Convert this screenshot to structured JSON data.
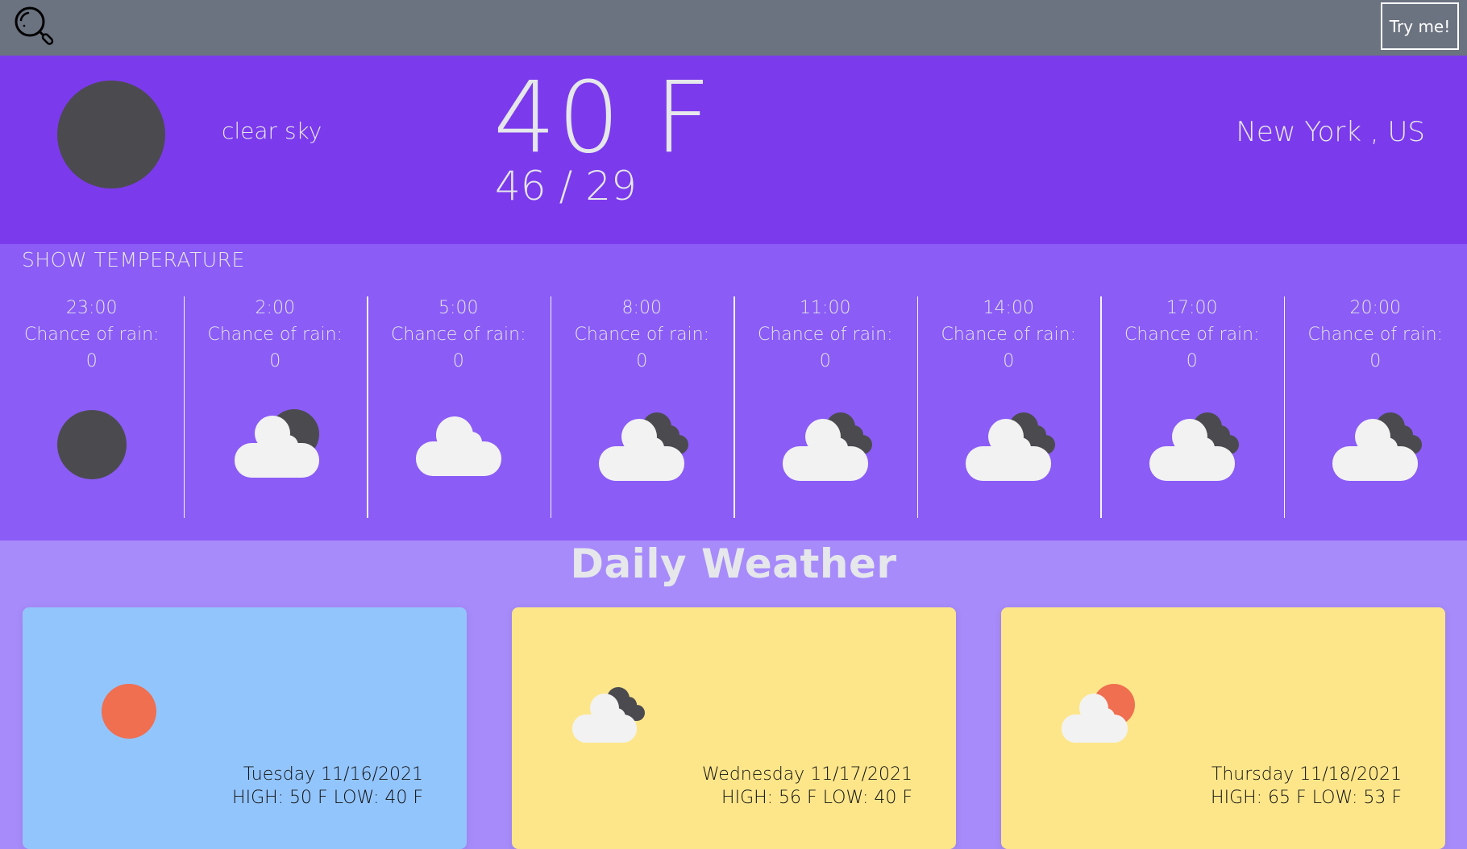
{
  "navbar": {
    "search_icon": "magnifying-glass-icon",
    "try_button_label": "Try me!"
  },
  "current": {
    "icon": "clear-night-icon",
    "description": "clear sky",
    "temperature": "40 F",
    "high_low": "46 / 29",
    "location": "New York , US"
  },
  "hourly": {
    "toggle_label": "SHOW TEMPERATURE",
    "rain_label": "Chance of rain:",
    "items": [
      {
        "time": "23:00",
        "rain": "0",
        "icon": "clear-night"
      },
      {
        "time": "2:00",
        "rain": "0",
        "icon": "few-clouds-night"
      },
      {
        "time": "5:00",
        "rain": "0",
        "icon": "cloud"
      },
      {
        "time": "8:00",
        "rain": "0",
        "icon": "broken-clouds-night"
      },
      {
        "time": "11:00",
        "rain": "0",
        "icon": "broken-clouds-night"
      },
      {
        "time": "14:00",
        "rain": "0",
        "icon": "broken-clouds-night"
      },
      {
        "time": "17:00",
        "rain": "0",
        "icon": "broken-clouds-night"
      },
      {
        "time": "20:00",
        "rain": "0",
        "icon": "broken-clouds-night"
      }
    ]
  },
  "daily": {
    "title": "Daily Weather",
    "items": [
      {
        "date": "Tuesday 11/16/2021",
        "high_low": "HIGH: 50 F LOW: 40 F",
        "icon": "sun",
        "color": "#93c5fd"
      },
      {
        "date": "Wednesday 11/17/2021",
        "high_low": "HIGH: 56 F LOW: 40 F",
        "icon": "broken-clouds",
        "color": "#fde68a"
      },
      {
        "date": "Thursday 11/18/2021",
        "high_low": "HIGH: 65 F LOW: 53 F",
        "icon": "few-clouds-day",
        "color": "#fde68a"
      }
    ]
  },
  "colors": {
    "navbar": "#6b7280",
    "current_bg": "#7c3aed",
    "hourly_bg": "#8b5cf6",
    "daily_bg": "#a78bfa",
    "moon": "#4b4b4f",
    "sun": "#ef6f50",
    "cloud": "#f2f2f2"
  }
}
